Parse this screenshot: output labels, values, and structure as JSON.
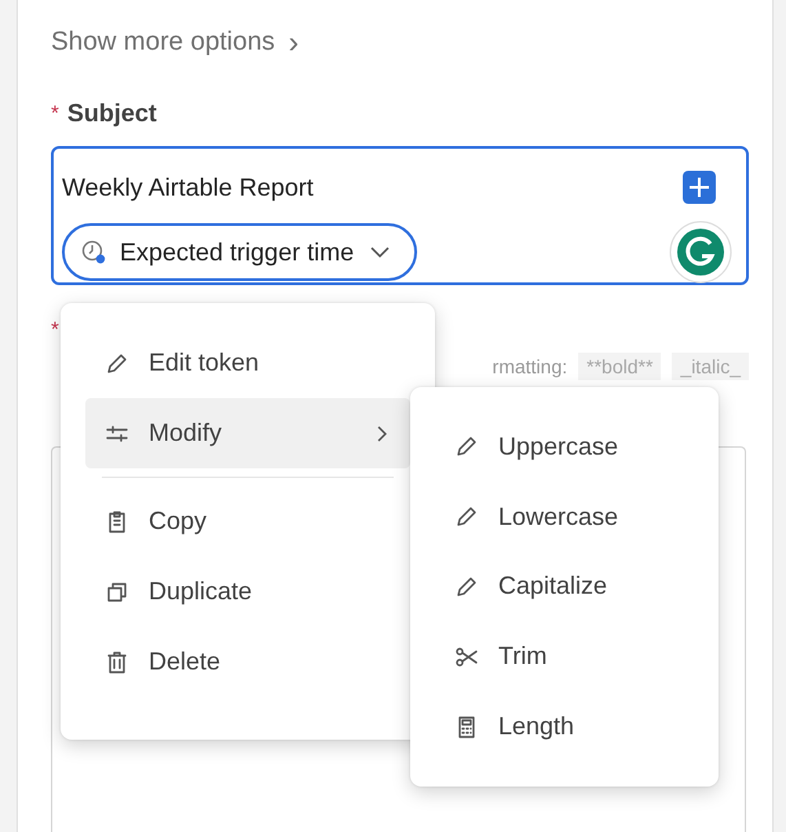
{
  "show_more": {
    "label": "Show more options",
    "chevron": "›"
  },
  "subject": {
    "required_mark": "*",
    "label": "Subject",
    "value": "Weekly Airtable Report",
    "token": {
      "label": "Expected trigger time"
    }
  },
  "body": {
    "required_mark": "*",
    "helper_end": "rmatting:",
    "chips": [
      "**bold**",
      "_italic_"
    ]
  },
  "context_menu": {
    "items": [
      {
        "kind": "action",
        "label": "Edit token",
        "selected": false
      },
      {
        "kind": "submenu",
        "label": "Modify",
        "selected": true
      },
      {
        "kind": "divider"
      },
      {
        "kind": "action",
        "label": "Copy",
        "selected": false
      },
      {
        "kind": "action",
        "label": "Duplicate",
        "selected": false
      },
      {
        "kind": "action",
        "label": "Delete",
        "selected": false
      }
    ]
  },
  "submenu": {
    "items": [
      {
        "kind": "action",
        "label": "Uppercase"
      },
      {
        "kind": "action",
        "label": "Lowercase"
      },
      {
        "kind": "action",
        "label": "Capitalize"
      },
      {
        "kind": "action",
        "label": "Trim"
      },
      {
        "kind": "action",
        "label": "Length"
      }
    ]
  }
}
